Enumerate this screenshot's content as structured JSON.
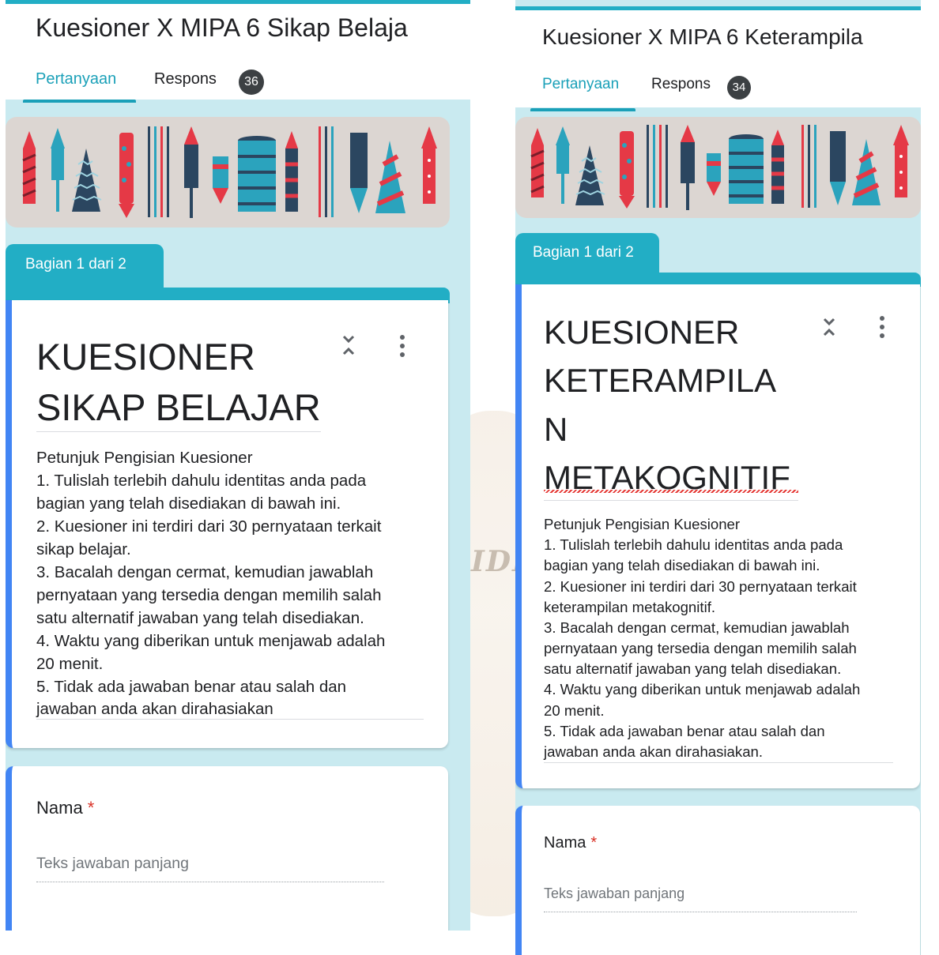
{
  "colors": {
    "accent": "#22aec5",
    "tab_active": "#1aa0b8",
    "card_left_border": "#4285f4",
    "required_star": "#d93025",
    "page_background": "#c9eaf0"
  },
  "watermark": {
    "text": "IDI"
  },
  "left_form": {
    "title": "Kuesioner X MIPA 6 Sikap Belaja",
    "tabs": {
      "questions": "Pertanyaan",
      "responses": "Respons",
      "response_count": "36"
    },
    "section_tab": "Bagian 1 dari 2",
    "card": {
      "title_lines": [
        "KUESIONER",
        "SIKAP BELAJAR"
      ],
      "description_lines": [
        "Petunjuk Pengisian Kuesioner",
        "1. Tulislah terlebih dahulu identitas anda pada",
        "bagian yang telah disediakan di bawah ini.",
        "2. Kuesioner ini terdiri dari 30 pernyataan terkait",
        "sikap belajar.",
        "3. Bacalah dengan cermat, kemudian jawablah",
        "pernyataan yang tersedia dengan memilih salah",
        "satu alternatif jawaban yang telah disediakan.",
        "4. Waktu yang diberikan untuk menjawab adalah",
        "20 menit.",
        "5. Tidak ada jawaban benar atau salah dan",
        "jawaban anda akan dirahasiakan"
      ]
    },
    "question": {
      "label": "Nama",
      "required_mark": "*",
      "placeholder": "Teks jawaban panjang"
    }
  },
  "right_form": {
    "title": "Kuesioner X MIPA 6 Keterampila",
    "tabs": {
      "questions": "Pertanyaan",
      "responses": "Respons",
      "response_count": "34"
    },
    "section_tab": "Bagian 1 dari 2",
    "card": {
      "title_lines": [
        "KUESIONER",
        "KETERAMPILA",
        "N",
        "METAKOGNITIF"
      ],
      "description_lines": [
        "Petunjuk Pengisian Kuesioner",
        "1. Tulislah terlebih dahulu identitas anda pada",
        "bagian yang telah disediakan di bawah ini.",
        "2. Kuesioner ini terdiri dari 30 pernyataan terkait",
        "keterampilan metakognitif.",
        "3. Bacalah dengan cermat, kemudian jawablah",
        "pernyataan yang tersedia dengan memilih salah",
        "satu alternatif jawaban yang telah disediakan.",
        "4. Waktu yang diberikan untuk menjawab adalah",
        "20 menit.",
        "5. Tidak ada jawaban benar atau salah dan",
        "jawaban anda akan dirahasiakan."
      ]
    },
    "question": {
      "label": "Nama",
      "required_mark": "*",
      "placeholder": "Teks jawaban panjang"
    }
  }
}
